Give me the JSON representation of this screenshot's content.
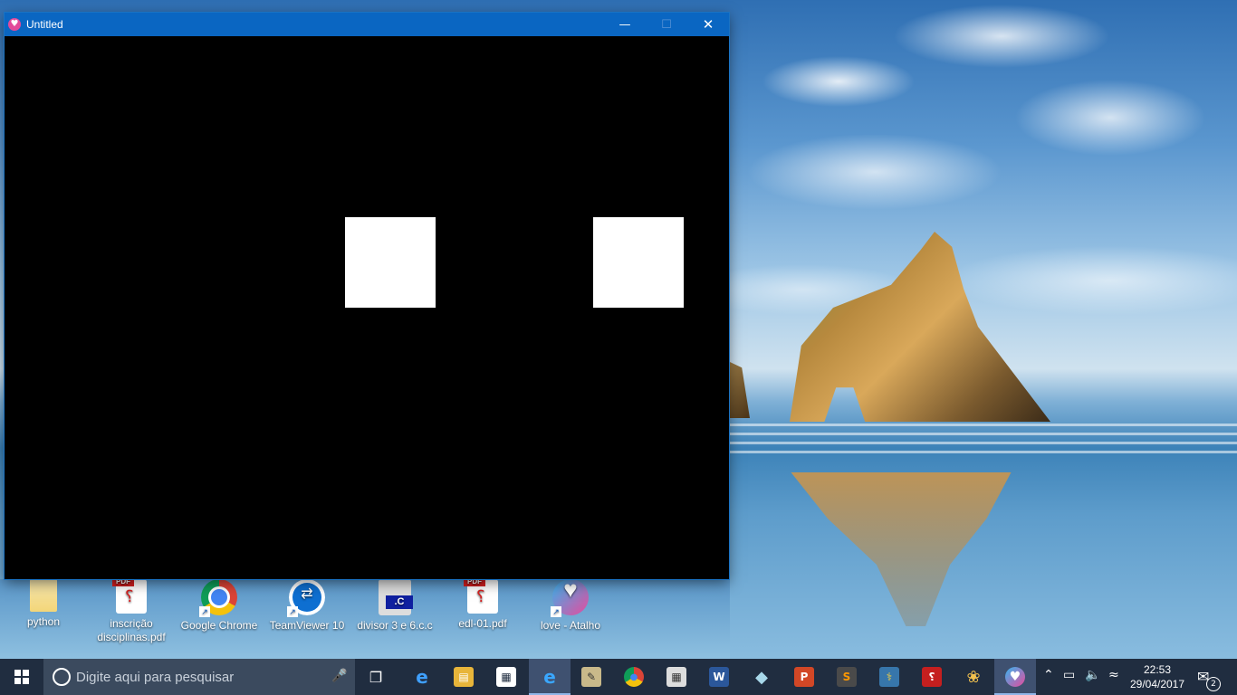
{
  "window": {
    "title": "Untitled",
    "minimize_glyph": "—",
    "maximize_glyph": "☐",
    "close_glyph": "✕"
  },
  "canvas": {
    "background": "#000000",
    "square_color": "#ffffff"
  },
  "desktop_icons": [
    {
      "label": "python",
      "icon": "folder-icon"
    },
    {
      "label": "inscrição disciplinas.pdf",
      "icon": "pdf-icon"
    },
    {
      "label": "Google Chrome",
      "icon": "chrome-icon"
    },
    {
      "label": "TeamViewer 10",
      "icon": "teamviewer-icon"
    },
    {
      "label": "divisor 3 e 6.c.c",
      "icon": "c-file-icon"
    },
    {
      "label": "edl-01.pdf",
      "icon": "pdf-icon"
    },
    {
      "label": "love - Atalho",
      "icon": "love-icon"
    }
  ],
  "taskbar": {
    "search_placeholder": "Digite aqui para pesquisar",
    "apps": [
      {
        "name": "task-view-icon",
        "glyph": "❐"
      },
      {
        "name": "edge-icon",
        "glyph": "e"
      },
      {
        "name": "file-explorer-icon",
        "glyph": "▤"
      },
      {
        "name": "store-icon",
        "glyph": "▦"
      },
      {
        "name": "internet-explorer-icon",
        "glyph": "e"
      },
      {
        "name": "paint-tool-icon",
        "glyph": "✎"
      },
      {
        "name": "chrome-icon",
        "glyph": "●"
      },
      {
        "name": "calculator-icon",
        "glyph": "▦"
      },
      {
        "name": "word-icon",
        "glyph": "W"
      },
      {
        "name": "eraser-app-icon",
        "glyph": "◆"
      },
      {
        "name": "powerpoint-icon",
        "glyph": "P"
      },
      {
        "name": "sublime-text-icon",
        "glyph": "S"
      },
      {
        "name": "python-icon",
        "glyph": "⚕"
      },
      {
        "name": "acrobat-icon",
        "glyph": "⸮"
      },
      {
        "name": "paint-icon",
        "glyph": "❀"
      },
      {
        "name": "love-icon",
        "glyph": "♥"
      }
    ],
    "clock_time": "22:53",
    "clock_date": "29/04/2017",
    "notification_count": "2"
  },
  "colors": {
    "titlebar": "#0a66c2",
    "taskbar": "#202d40"
  }
}
